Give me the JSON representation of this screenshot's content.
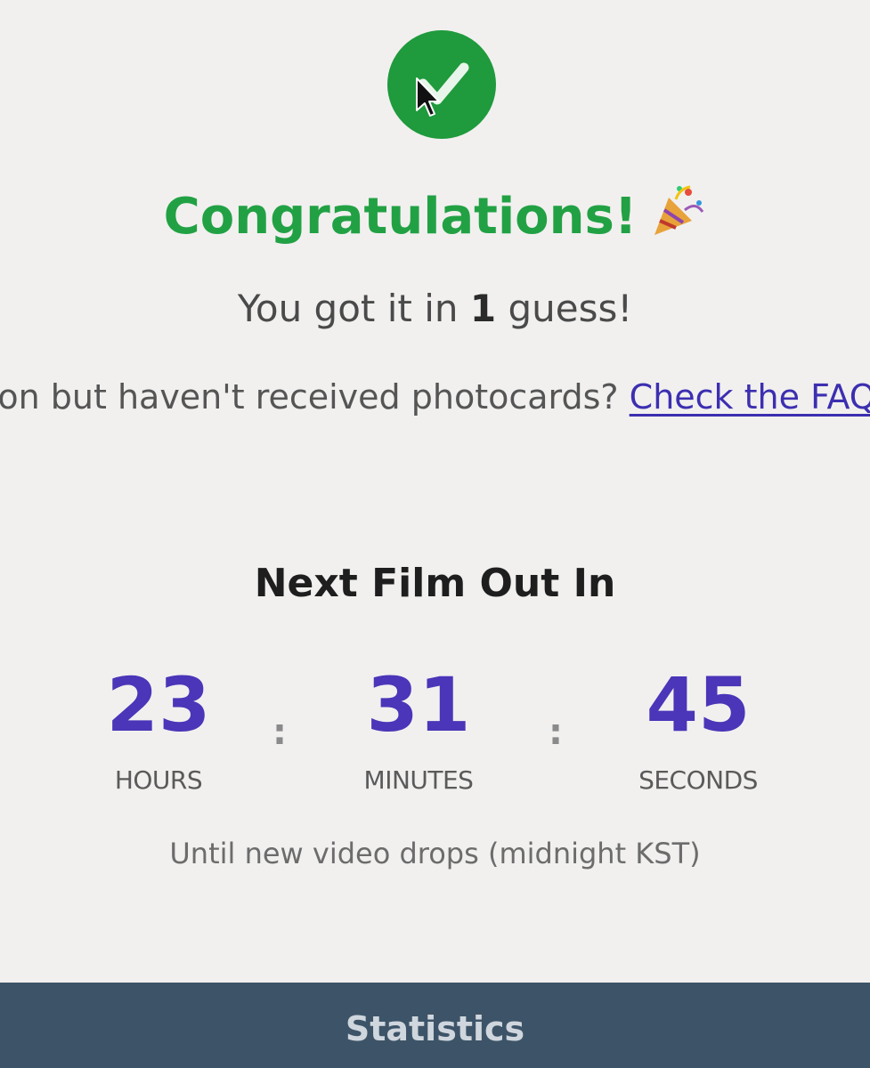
{
  "result": {
    "check_icon": "check-icon",
    "title": "Congratulations!",
    "title_emoji_icon": "party-popper-icon",
    "title_color": "#22a144",
    "guess_prefix": "You got it in ",
    "guess_count": "1",
    "guess_suffix": " guess!",
    "faq_prompt": "Won but haven't received photocards? ",
    "faq_link": "Check the FAQ"
  },
  "countdown": {
    "title": "Next Film Out In",
    "hours": {
      "value": "23",
      "label": "HOURS"
    },
    "minutes": {
      "value": "31",
      "label": "MINUTES"
    },
    "seconds": {
      "value": "45",
      "label": "SECONDS"
    },
    "separator": ":",
    "note": "Until new video drops (midnight KST)",
    "accent_color": "#4b35b8"
  },
  "footer": {
    "statistics_label": "Statistics",
    "bar_color": "#3d5468"
  },
  "cursor_icon": "mouse-pointer-icon"
}
